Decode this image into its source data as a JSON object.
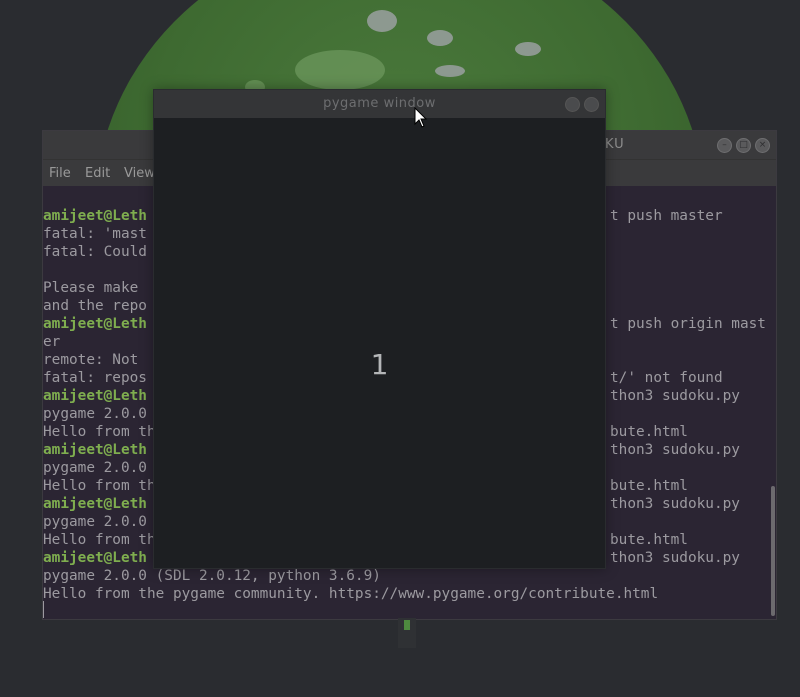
{
  "pygame_window": {
    "title": "pygame window",
    "display_number": "1"
  },
  "terminal": {
    "title_suffix": "SUDOKU",
    "menu": [
      "File",
      "Edit",
      "View"
    ],
    "lines": [
      {
        "prompt": "amijeet@Leth",
        "text": "",
        "right": "t push master"
      },
      {
        "prompt": "",
        "text": "fatal: 'mast",
        "right": ""
      },
      {
        "prompt": "",
        "text": "fatal: Could",
        "right": ""
      },
      {
        "prompt": "",
        "text": "",
        "right": ""
      },
      {
        "prompt": "",
        "text": "Please make",
        "right": ""
      },
      {
        "prompt": "",
        "text": "and the repo",
        "right": ""
      },
      {
        "prompt": "amijeet@Leth",
        "text": "",
        "right": "t push origin mast"
      },
      {
        "prompt": "",
        "text": "er",
        "right": ""
      },
      {
        "prompt": "",
        "text": "remote: Not",
        "right": ""
      },
      {
        "prompt": "",
        "text": "fatal: repos",
        "right": "t/' not found"
      },
      {
        "prompt": "amijeet@Leth",
        "text": "",
        "right": "thon3 sudoku.py"
      },
      {
        "prompt": "",
        "text": "pygame 2.0.0",
        "right": ""
      },
      {
        "prompt": "",
        "text": "Hello from th",
        "right": "bute.html"
      },
      {
        "prompt": "amijeet@Leth",
        "text": "",
        "right": "thon3 sudoku.py"
      },
      {
        "prompt": "",
        "text": "pygame 2.0.0",
        "right": ""
      },
      {
        "prompt": "",
        "text": "Hello from th",
        "right": "bute.html"
      },
      {
        "prompt": "amijeet@Leth",
        "text": "",
        "right": "thon3 sudoku.py"
      },
      {
        "prompt": "",
        "text": "pygame 2.0.0",
        "right": ""
      },
      {
        "prompt": "",
        "text": "Hello from th",
        "right": "bute.html"
      },
      {
        "prompt": "amijeet@Leth",
        "text": "",
        "right": "thon3 sudoku.py"
      },
      {
        "prompt": "",
        "text": "pygame 2.0.0 (SDL 2.0.12, python 3.6.9)",
        "right": ""
      },
      {
        "prompt": "",
        "text": "Hello from the pygame community. https://www.pygame.org/contribute.html",
        "right": ""
      }
    ]
  },
  "colors": {
    "prompt": "#7fae4f",
    "terminal_text": "#9c9aa0",
    "pygame_bg": "#1d1f22"
  }
}
